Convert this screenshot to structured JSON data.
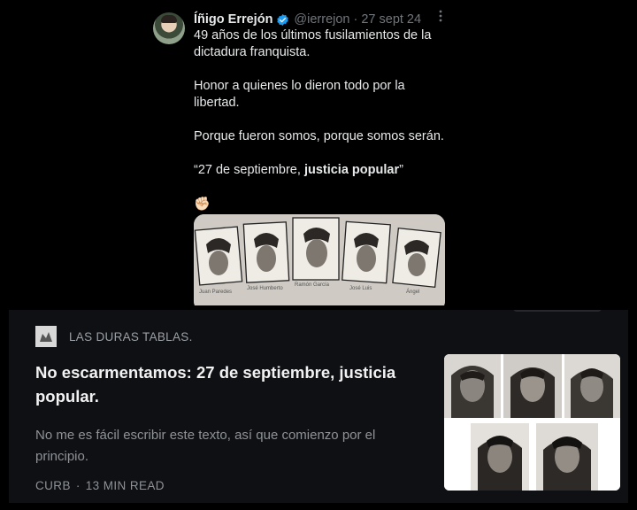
{
  "tweet": {
    "author_name": "Íñigo Errejón",
    "handle": "@ierrejon",
    "separator": "·",
    "date": "27 sept 24",
    "paragraphs": [
      "49 años de los últimos fusilamientos de la dictadura franquista.",
      "Honor a quienes lo dieron todo por la libertad.",
      "Porque fueron somos, porque somos serán."
    ],
    "quote_open": "“27 de septiembre, ",
    "quote_bold": "justicia popular",
    "quote_close": "”",
    "emoji": "✊🏻",
    "image_captions": [
      "Juan Paredes Manot \"Txiki\"",
      "José Humberto Baena Alonso",
      "Ramón García Sanz",
      "José Luis Sánchez-Bravo",
      "Ángel Otaegui"
    ]
  },
  "article": {
    "publication": "LAS DURAS TABLAS.",
    "title": "No escarmentamos: 27 de septiembre, justicia popular.",
    "excerpt": "No me es fácil escribir este texto, así que comienzo por el principio.",
    "source": "CURB",
    "meta_separator": "·",
    "read_time": "13 MIN READ"
  },
  "colors": {
    "background": "#000000",
    "text_primary": "#e7e9ea",
    "text_secondary": "#71767b",
    "verified_blue": "#1d9bf0",
    "card_background": "#0f1013"
  },
  "icons": {
    "verified": "verified-badge-icon",
    "more": "more-options-icon"
  }
}
